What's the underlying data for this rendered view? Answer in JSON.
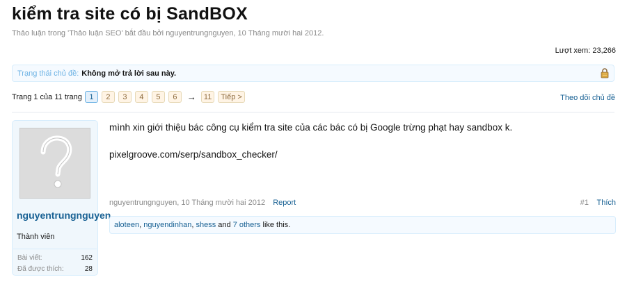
{
  "thread": {
    "title": "kiểm tra site có bị SandBOX",
    "meta_prefix": "Thảo luận trong '",
    "forum": "Thảo luận SEO",
    "meta_middle": "' bắt đầu bởi ",
    "author": "nguyentrungnguyen",
    "meta_date": ", 10 Tháng mười hai 2012.",
    "views_label": "Lượt xem:",
    "views": "23,266"
  },
  "status": {
    "label": "Trạng thái chủ đề:",
    "value": "Không mở trả lời sau này."
  },
  "pager": {
    "info": "Trang 1 của 11 trang",
    "pages": [
      "1",
      "2",
      "3",
      "4",
      "5",
      "6"
    ],
    "arrow": "→",
    "last": "11",
    "next": "Tiếp >"
  },
  "follow_label": "Theo dõi chủ đề",
  "user": {
    "name": "nguyentrungnguyen",
    "title": "Thành viên",
    "posts_label": "Bài viết:",
    "posts": "162",
    "likes_label": "Đã được thích:",
    "likes": "28"
  },
  "post": {
    "line1": "mình xin giới thiệu bác công cụ kiểm tra site của các bác có bị Google trừng phạt hay sandbox k.",
    "line2": "pixelgroove.com/serp/sandbox_checker/",
    "author_date": "nguyentrungnguyen, 10 Tháng mười hai 2012",
    "report": "Report",
    "number": "#1",
    "like": "Thích"
  },
  "likes_bar": {
    "names": [
      "aloteen",
      "nguyendinhan",
      "shess"
    ],
    "sep": ", ",
    "and": " and ",
    "others": "7 others",
    "suffix": " like this."
  }
}
